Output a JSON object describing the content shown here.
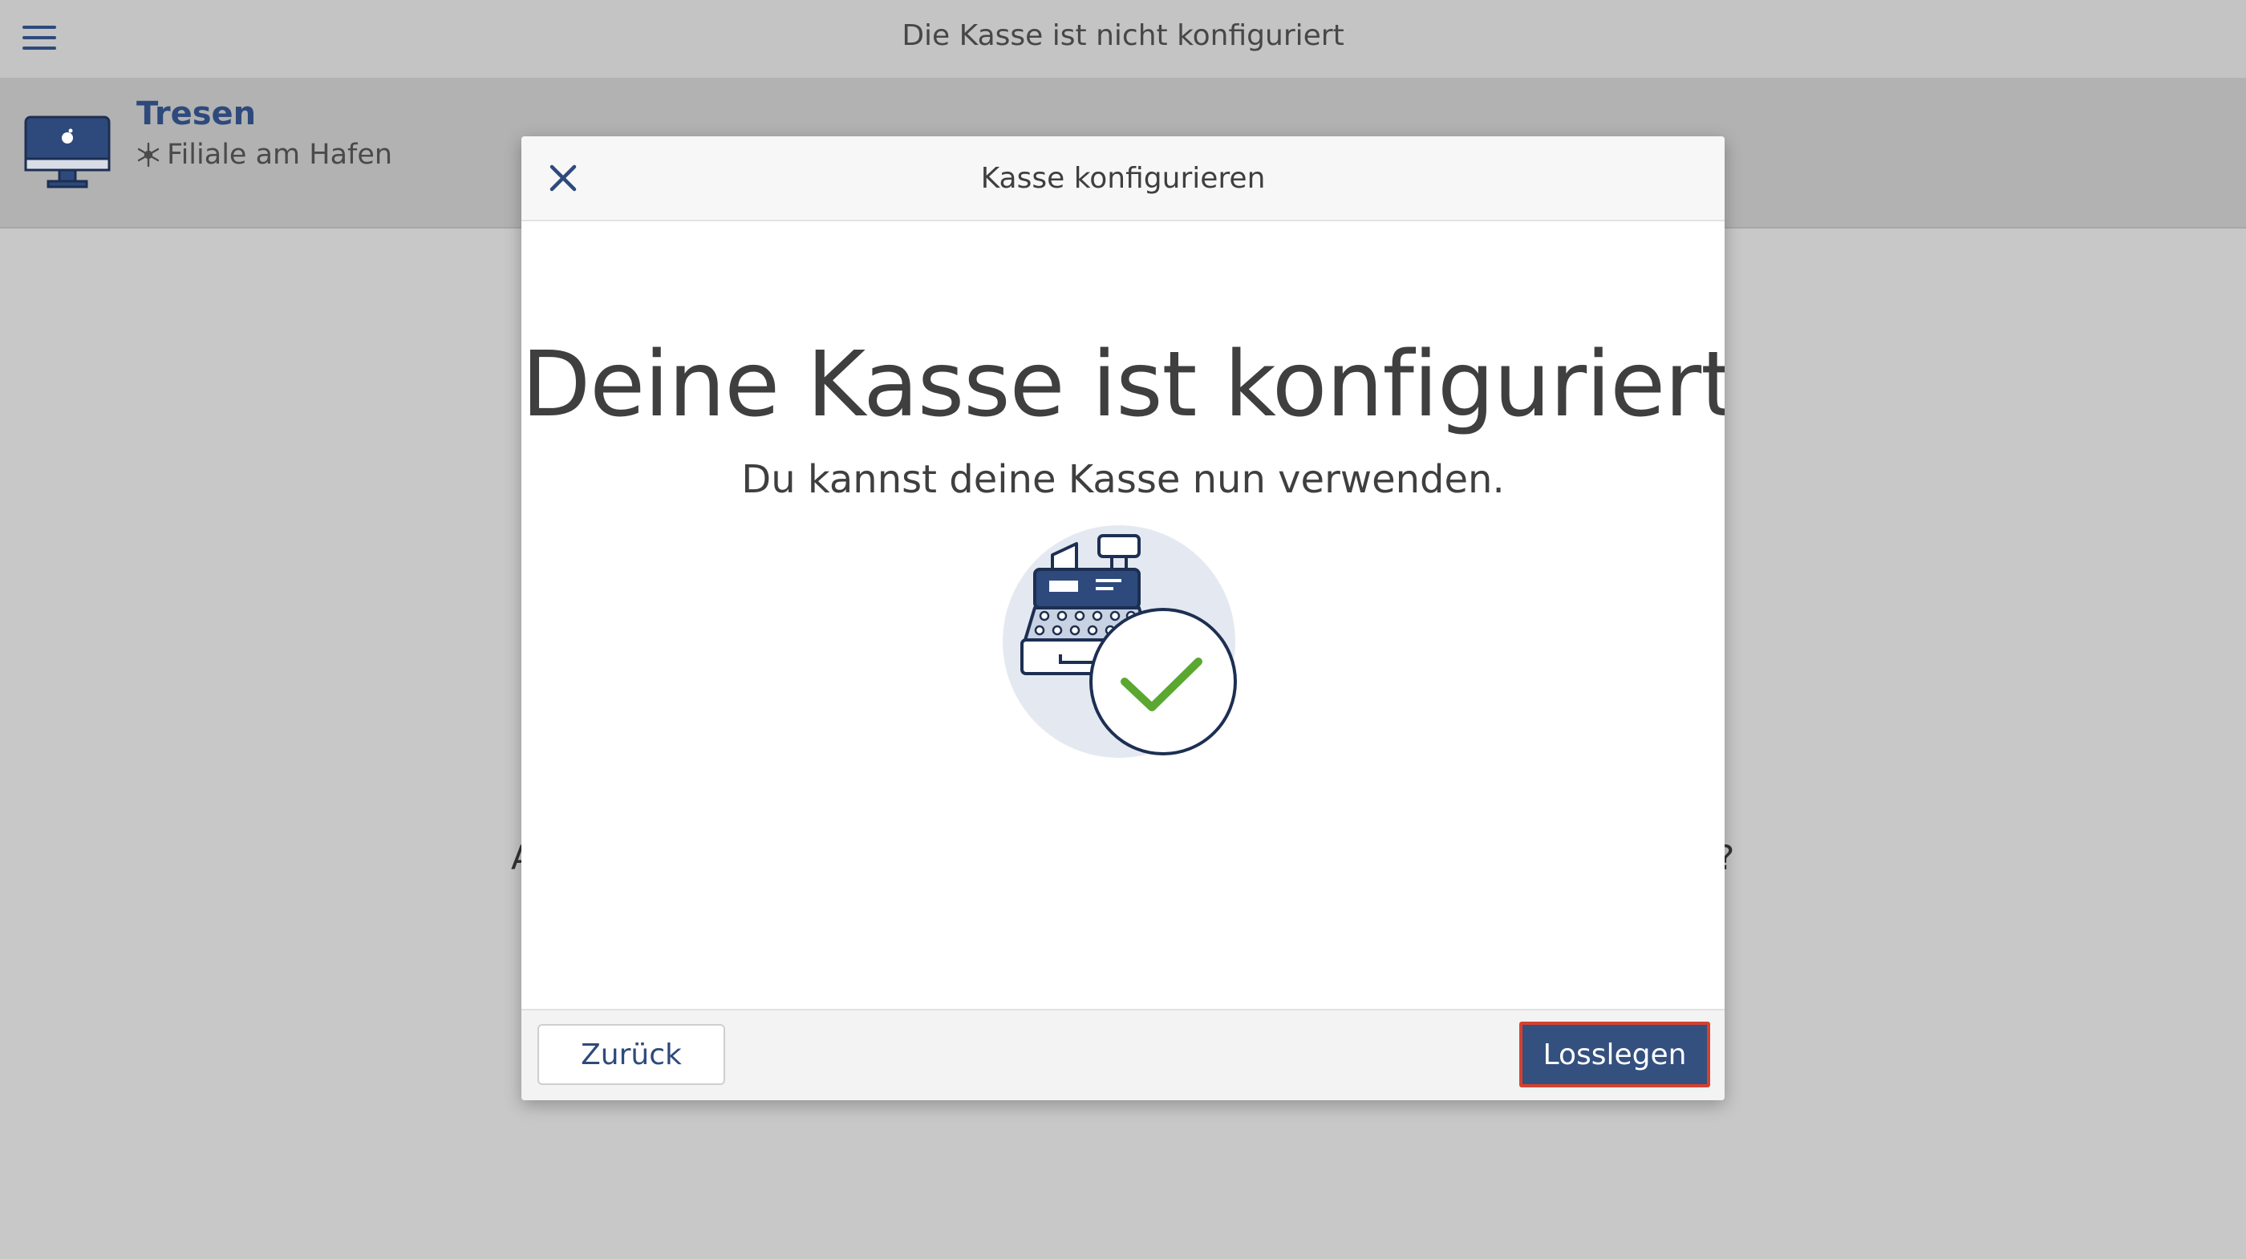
{
  "topbar": {
    "title": "Die Kasse ist nicht konfiguriert",
    "menu_icon": "hamburger-menu-icon"
  },
  "device": {
    "name": "Tresen",
    "branch": "Filiale am Hafen",
    "icon": "desktop-computer-icon",
    "branch_icon": "snowflake-icon"
  },
  "background": {
    "left_fragment": "A",
    "right_fragment": "?"
  },
  "modal": {
    "title": "Kasse konfigurieren",
    "headline": "Deine Kasse ist konfiguriert",
    "subline": "Du kannst deine Kasse nun verwenden.",
    "illustration": "cash-register-check-icon",
    "back_label": "Zurück",
    "start_label": "Losslegen"
  },
  "colors": {
    "primary": "#34507f",
    "accent_outline": "#d6412e",
    "success": "#5aa832",
    "background": "#c8c8c8"
  }
}
